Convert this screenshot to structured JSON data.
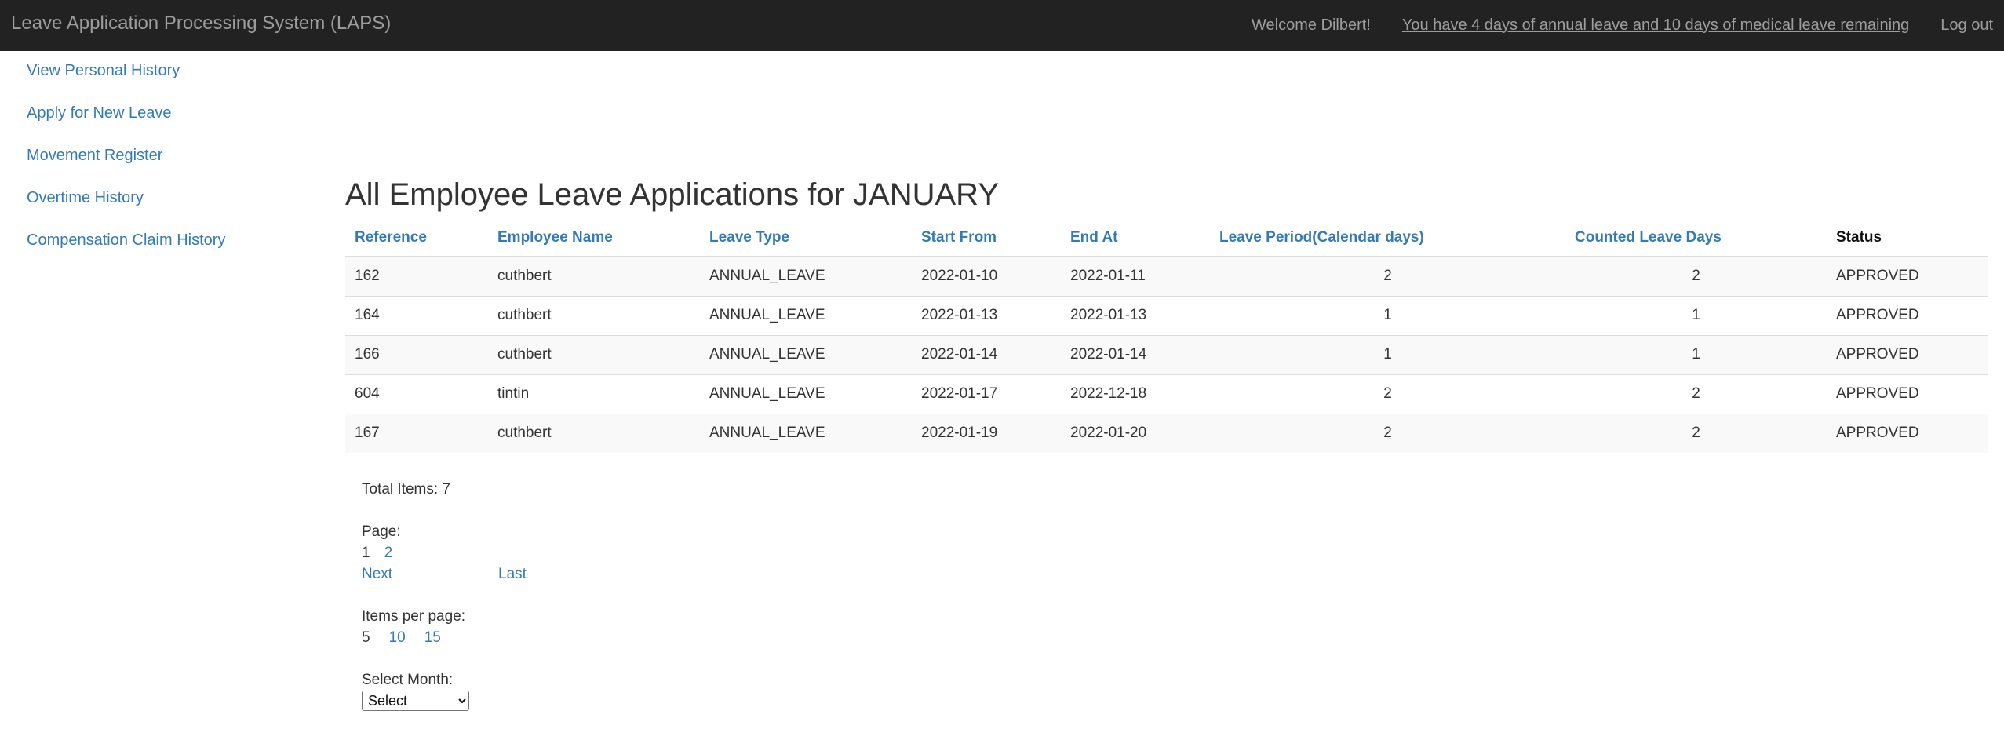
{
  "navbar": {
    "brand": "Leave Application Processing System (LAPS)",
    "welcome": "Welcome Dilbert!",
    "leave_remaining": "You have 4 days of annual leave and 10 days of medical leave remaining",
    "logout": "Log out"
  },
  "sidebar": {
    "items": [
      {
        "label": "View Personal History"
      },
      {
        "label": "Apply for New Leave"
      },
      {
        "label": "Movement Register"
      },
      {
        "label": "Overtime History"
      },
      {
        "label": "Compensation Claim History"
      }
    ]
  },
  "main": {
    "title": "All Employee Leave Applications for JANUARY",
    "columns": [
      "Reference",
      "Employee Name",
      "Leave Type",
      "Start From",
      "End At",
      "Leave Period(Calendar days)",
      "Counted Leave Days",
      "Status"
    ],
    "rows": [
      {
        "ref": "162",
        "name": "cuthbert",
        "type": "ANNUAL_LEAVE",
        "start": "2022-01-10",
        "end": "2022-01-11",
        "period": "2",
        "counted": "2",
        "status": "APPROVED"
      },
      {
        "ref": "164",
        "name": "cuthbert",
        "type": "ANNUAL_LEAVE",
        "start": "2022-01-13",
        "end": "2022-01-13",
        "period": "1",
        "counted": "1",
        "status": "APPROVED"
      },
      {
        "ref": "166",
        "name": "cuthbert",
        "type": "ANNUAL_LEAVE",
        "start": "2022-01-14",
        "end": "2022-01-14",
        "period": "1",
        "counted": "1",
        "status": "APPROVED"
      },
      {
        "ref": "604",
        "name": "tintin",
        "type": "ANNUAL_LEAVE",
        "start": "2022-01-17",
        "end": "2022-12-18",
        "period": "2",
        "counted": "2",
        "status": "APPROVED"
      },
      {
        "ref": "167",
        "name": "cuthbert",
        "type": "ANNUAL_LEAVE",
        "start": "2022-01-19",
        "end": "2022-01-20",
        "period": "2",
        "counted": "2",
        "status": "APPROVED"
      }
    ]
  },
  "pagination": {
    "total_items": "Total Items: 7",
    "page_label": "Page:",
    "current_page": "1",
    "other_page": "2",
    "next": "Next",
    "last": "Last",
    "items_per_page_label": "Items per page:",
    "per_page_current": "5",
    "per_page_10": "10",
    "per_page_15": "15",
    "select_month_label": "Select Month:",
    "select_month_value": "Select"
  }
}
